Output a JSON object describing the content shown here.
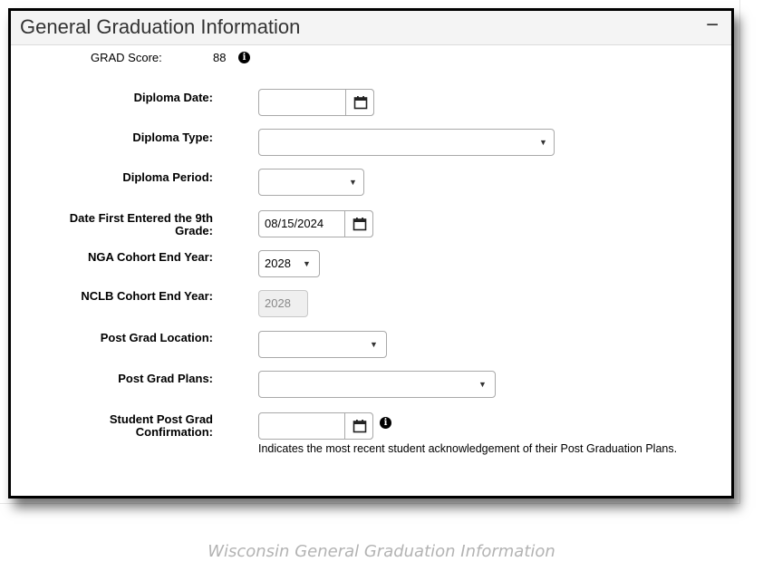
{
  "panel": {
    "title": "General Graduation Information",
    "collapse_glyph": "−"
  },
  "grad_score": {
    "label": "GRAD Score:",
    "value": "88"
  },
  "fields": {
    "diploma_date": {
      "label": "Diploma Date:",
      "value": ""
    },
    "diploma_type": {
      "label": "Diploma Type:",
      "value": ""
    },
    "diploma_period": {
      "label": "Diploma Period:",
      "value": ""
    },
    "first_entered_9th": {
      "label_line1": "Date First Entered the 9th",
      "label_line2": "Grade:",
      "value": "08/15/2024"
    },
    "nga_cohort": {
      "label": "NGA Cohort End Year:",
      "value": "2028"
    },
    "nclb_cohort": {
      "label": "NCLB Cohort End Year:",
      "value": "2028"
    },
    "post_grad_location": {
      "label": "Post Grad Location:",
      "value": ""
    },
    "post_grad_plans": {
      "label": "Post Grad Plans:",
      "value": ""
    },
    "student_confirmation": {
      "label_line1": "Student Post Grad",
      "label_line2": "Confirmation:",
      "value": "",
      "helper": "Indicates the most recent student acknowledgement of their Post Graduation Plans."
    }
  },
  "icons": {
    "info": "info-icon",
    "calendar": "calendar-icon",
    "dropdown": "chevron-down-icon"
  },
  "caption": "Wisconsin General Graduation Information"
}
